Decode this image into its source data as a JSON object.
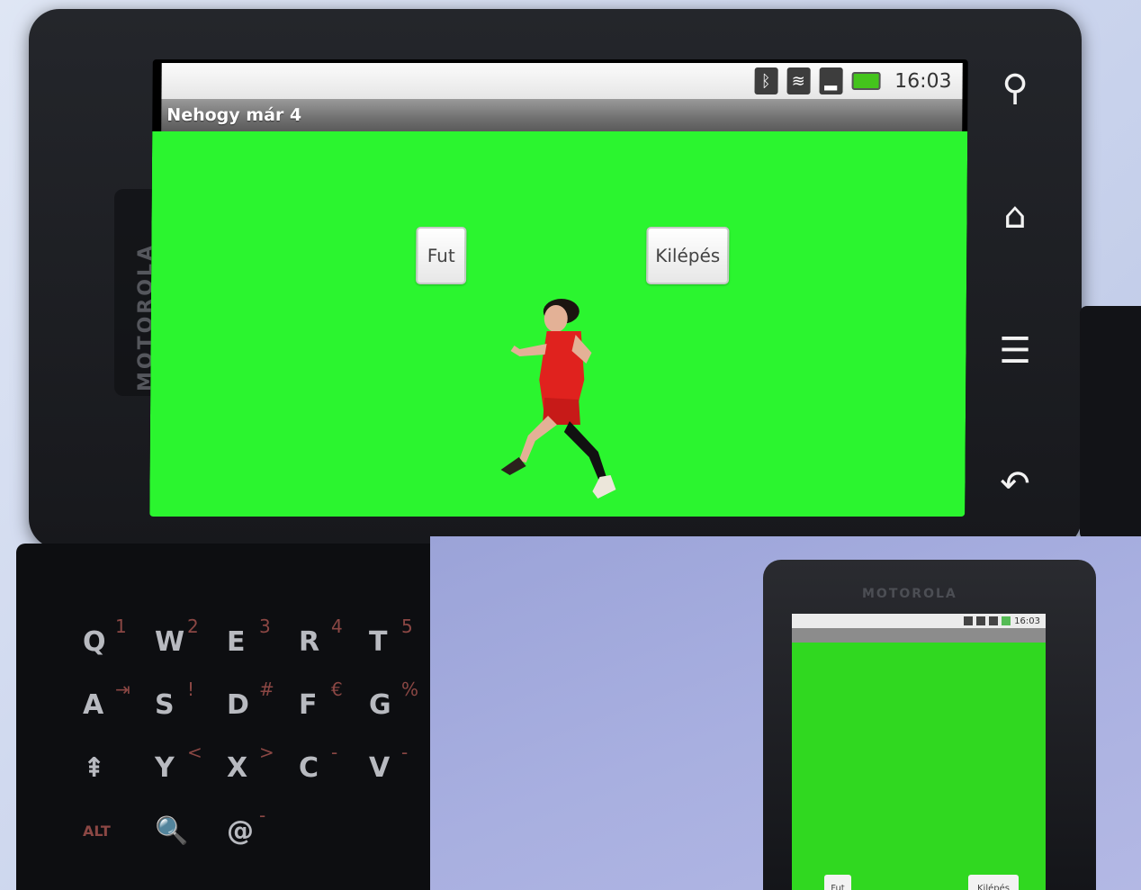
{
  "device": {
    "brand": "MOTOROLA"
  },
  "statusbar": {
    "icons": [
      "bluetooth-icon",
      "wifi-icon",
      "signal-icon",
      "battery-icon"
    ],
    "clock": "16:03"
  },
  "app": {
    "title": "Nehogy már 4"
  },
  "buttons": {
    "run_label": "Fut",
    "exit_label": "Kilépés"
  },
  "softkeys": [
    "search-icon",
    "home-icon",
    "menu-icon",
    "back-icon"
  ],
  "keyboard": {
    "rows": [
      [
        {
          "main": "Q",
          "alt": "1"
        },
        {
          "main": "W",
          "alt": "2"
        },
        {
          "main": "E",
          "alt": "3"
        },
        {
          "main": "R",
          "alt": "4"
        },
        {
          "main": "T",
          "alt": "5"
        }
      ],
      [
        {
          "main": "A",
          "alt": "⇥"
        },
        {
          "main": "S",
          "alt": "!"
        },
        {
          "main": "D",
          "alt": "#"
        },
        {
          "main": "F",
          "alt": "€"
        },
        {
          "main": "G",
          "alt": "%"
        }
      ],
      [
        {
          "main": "⇞",
          "alt": ""
        },
        {
          "main": "Y",
          "alt": "<"
        },
        {
          "main": "X",
          "alt": ">"
        },
        {
          "main": "C",
          "alt": "-"
        },
        {
          "main": "V",
          "alt": "-"
        }
      ],
      [
        {
          "main": "ALT",
          "alt": ""
        },
        {
          "main": "🔍",
          "alt": ""
        },
        {
          "main": "@",
          "alt": "-"
        }
      ]
    ]
  },
  "inset": {
    "brand": "MOTOROLA",
    "clock": "16:03",
    "run_label": "Fut",
    "exit_label": "Kilépés"
  },
  "colors": {
    "game_bg": "#2bf52f",
    "inset_bg": "#a8afe0"
  }
}
